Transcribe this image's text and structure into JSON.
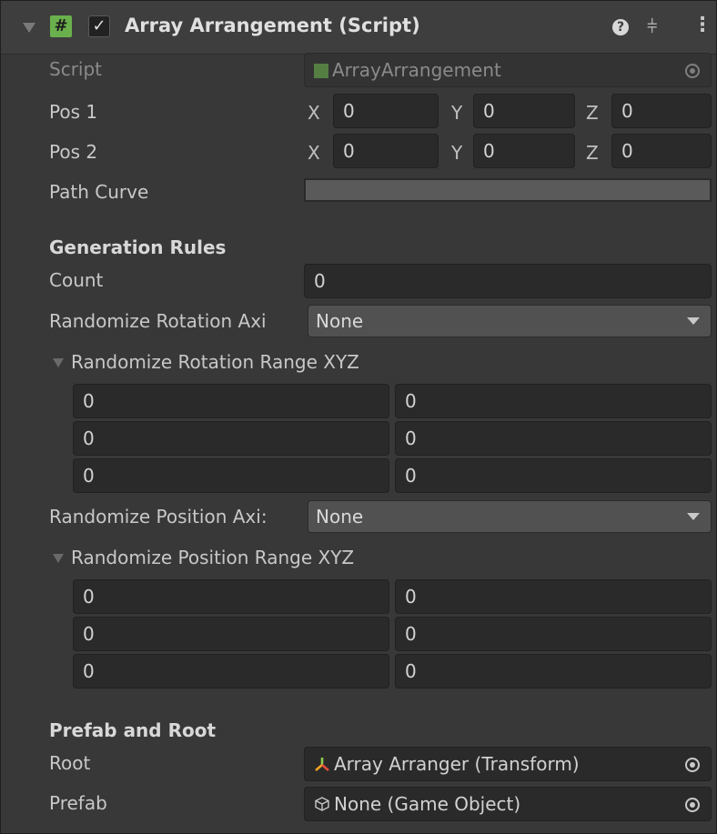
{
  "header": {
    "title": "Array Arrangement (Script)",
    "enabled": true,
    "icons": [
      "foldout-arrow-icon",
      "script-hash-icon",
      "checkbox-icon",
      "help-icon",
      "presets-icon",
      "kebab-menu-icon"
    ]
  },
  "script": {
    "label": "Script",
    "value": "ArrayArrangement"
  },
  "pos1": {
    "label": "Pos 1",
    "x_label": "X",
    "y_label": "Y",
    "z_label": "Z",
    "x": "0",
    "y": "0",
    "z": "0"
  },
  "pos2": {
    "label": "Pos 2",
    "x_label": "X",
    "y_label": "Y",
    "z_label": "Z",
    "x": "0",
    "y": "0",
    "z": "0"
  },
  "path_curve": {
    "label": "Path Curve"
  },
  "generation": {
    "heading": "Generation Rules",
    "count_label": "Count",
    "count": "0",
    "rot_axis_label": "Randomize Rotation Axi",
    "rot_axis_value": "None",
    "rot_range_label": "Randomize Rotation Range XYZ",
    "rot_range": [
      [
        "0",
        "0"
      ],
      [
        "0",
        "0"
      ],
      [
        "0",
        "0"
      ]
    ],
    "pos_axis_label": "Randomize Position Axi:",
    "pos_axis_value": "None",
    "pos_range_label": "Randomize Position Range XYZ",
    "pos_range": [
      [
        "0",
        "0"
      ],
      [
        "0",
        "0"
      ],
      [
        "0",
        "0"
      ]
    ]
  },
  "prefab_root": {
    "heading": "Prefab and Root",
    "root_label": "Root",
    "root_value": "Array Arranger (Transform)",
    "prefab_label": "Prefab",
    "prefab_value": "None (Game Object)"
  },
  "colors": {
    "background": "#383838",
    "header": "#3e3e3e",
    "field": "#2a2a2a",
    "dropdown": "#515151",
    "script_icon": "#6ab04c"
  }
}
